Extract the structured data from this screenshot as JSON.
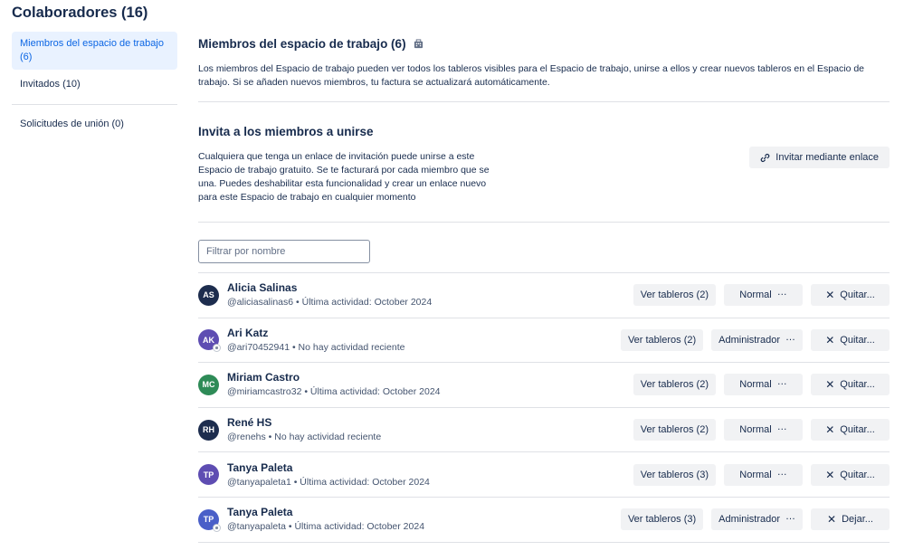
{
  "page": {
    "title": "Colaboradores (16)"
  },
  "sidebar": {
    "items": [
      {
        "label": "Miembros del espacio de trabajo (6)",
        "active": true
      },
      {
        "label": "Invitados (10)",
        "active": false
      },
      {
        "label": "Solicitudes de unión (0)",
        "active": false
      }
    ]
  },
  "members_section": {
    "title": "Miembros del espacio de trabajo (6)",
    "description": "Los miembros del Espacio de trabajo pueden ver todos los tableros visibles para el Espacio de trabajo, unirse a ellos y crear nuevos tableros en el Espacio de trabajo. Si se añaden nuevos miembros, tu factura se actualizará automáticamente."
  },
  "invite_section": {
    "title": "Invita a los miembros a unirse",
    "description": "Cualquiera que tenga un enlace de invitación puede unirse a este Espacio de trabajo gratuito. Se te facturará por cada miembro que se una. Puedes deshabilitar esta funcionalidad y crear un enlace nuevo para este Espacio de trabajo en cualquier momento",
    "button_label": "Invitar mediante enlace"
  },
  "filter": {
    "placeholder": "Filtrar por nombre",
    "value": ""
  },
  "members": [
    {
      "initials": "AS",
      "avatar_color": "#1d2d4e",
      "admin": false,
      "name": "Alicia Salinas",
      "meta": "@aliciasalinas6 • Última actividad: October 2024",
      "boards_label": "Ver tableros (2)",
      "role_label": "Normal",
      "action_label": "Quitar..."
    },
    {
      "initials": "AK",
      "avatar_color": "#5e4db2",
      "admin": true,
      "name": "Ari Katz",
      "meta": "@ari70452941 • No hay actividad reciente",
      "boards_label": "Ver tableros (2)",
      "role_label": "Administrador",
      "action_label": "Quitar..."
    },
    {
      "initials": "MC",
      "avatar_color": "#2e8b57",
      "admin": false,
      "name": "Miriam Castro",
      "meta": "@miriamcastro32 • Última actividad: October 2024",
      "boards_label": "Ver tableros (2)",
      "role_label": "Normal",
      "action_label": "Quitar..."
    },
    {
      "initials": "RH",
      "avatar_color": "#1d2d4e",
      "admin": false,
      "name": "René HS",
      "meta": "@renehs • No hay actividad reciente",
      "boards_label": "Ver tableros (2)",
      "role_label": "Normal",
      "action_label": "Quitar..."
    },
    {
      "initials": "TP",
      "avatar_color": "#5e4db2",
      "admin": false,
      "name": "Tanya Paleta",
      "meta": "@tanyapaleta1 • Última actividad: October 2024",
      "boards_label": "Ver tableros (3)",
      "role_label": "Normal",
      "action_label": "Quitar..."
    },
    {
      "initials": "TP",
      "avatar_color": "#4a5fc8",
      "admin": true,
      "name": "Tanya Paleta",
      "meta": "@tanyapaleta • Última actividad: October 2024",
      "boards_label": "Ver tableros (3)",
      "role_label": "Administrador",
      "action_label": "Dejar..."
    }
  ],
  "icons": {
    "workspace_icon": "building-icon",
    "link_icon": "link-icon",
    "more_icon": "ellipsis-icon",
    "remove_icon": "close-icon"
  },
  "colors": {
    "accent": "#0c66e4",
    "active_bg": "#e9f2ff",
    "button_bg": "#f1f2f4",
    "text": "#172b4d"
  }
}
